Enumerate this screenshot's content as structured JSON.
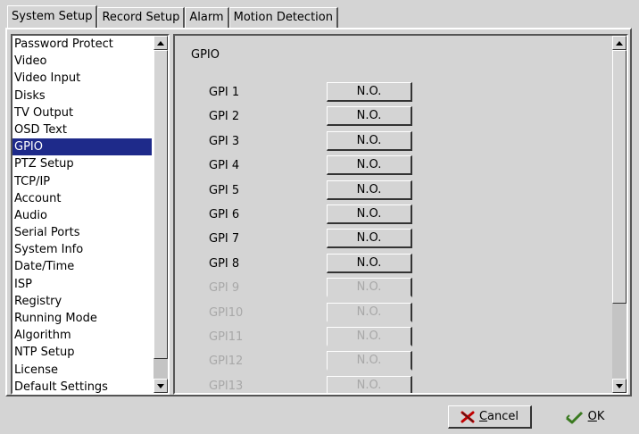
{
  "tabs": [
    {
      "label": "System Setup",
      "active": true
    },
    {
      "label": "Record Setup",
      "active": false
    },
    {
      "label": "Alarm",
      "active": false
    },
    {
      "label": "Motion Detection",
      "active": false
    }
  ],
  "sidebar": {
    "items": [
      {
        "label": "Password Protect"
      },
      {
        "label": "Video"
      },
      {
        "label": "Video Input"
      },
      {
        "label": "Disks"
      },
      {
        "label": "TV Output"
      },
      {
        "label": "OSD Text"
      },
      {
        "label": "GPIO",
        "selected": true
      },
      {
        "label": "PTZ Setup"
      },
      {
        "label": "TCP/IP"
      },
      {
        "label": "Account"
      },
      {
        "label": "Audio"
      },
      {
        "label": "Serial Ports"
      },
      {
        "label": "System Info"
      },
      {
        "label": "Date/Time"
      },
      {
        "label": "ISP"
      },
      {
        "label": "Registry"
      },
      {
        "label": "Running Mode"
      },
      {
        "label": "Algorithm"
      },
      {
        "label": "NTP Setup"
      },
      {
        "label": "License"
      },
      {
        "label": "Default Settings"
      }
    ]
  },
  "content": {
    "title": "GPIO",
    "rows": [
      {
        "label": "GPI 1",
        "value": "N.O.",
        "enabled": true
      },
      {
        "label": "GPI 2",
        "value": "N.O.",
        "enabled": true
      },
      {
        "label": "GPI 3",
        "value": "N.O.",
        "enabled": true
      },
      {
        "label": "GPI 4",
        "value": "N.O.",
        "enabled": true
      },
      {
        "label": "GPI 5",
        "value": "N.O.",
        "enabled": true
      },
      {
        "label": "GPI 6",
        "value": "N.O.",
        "enabled": true
      },
      {
        "label": "GPI 7",
        "value": "N.O.",
        "enabled": true
      },
      {
        "label": "GPI 8",
        "value": "N.O.",
        "enabled": true
      },
      {
        "label": "GPI 9",
        "value": "N.O.",
        "enabled": false
      },
      {
        "label": "GPI10",
        "value": "N.O.",
        "enabled": false
      },
      {
        "label": "GPI11",
        "value": "N.O.",
        "enabled": false
      },
      {
        "label": "GPI12",
        "value": "N.O.",
        "enabled": false
      },
      {
        "label": "GPI13",
        "value": "N.O.",
        "enabled": false
      }
    ]
  },
  "footer": {
    "cancel_label": "Cancel",
    "ok_label": "OK",
    "cancel_icon": "red-x-icon",
    "ok_icon": "green-check-arrow-icon"
  },
  "colors": {
    "selection": "#1e2a8a",
    "background": "#d4d4d4",
    "disabled_text": "#a8a8a8"
  }
}
